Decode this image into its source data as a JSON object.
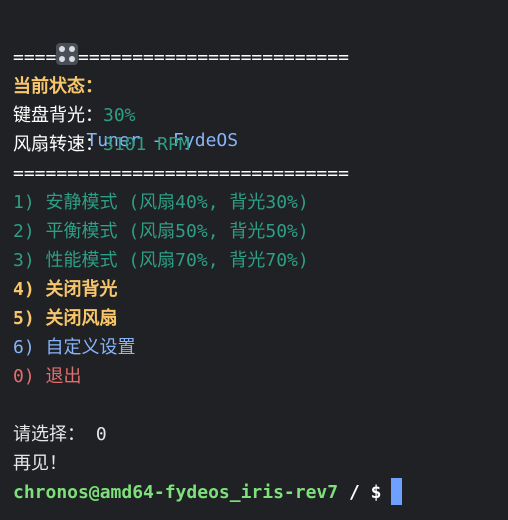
{
  "window": {
    "icon": "control-knobs-icon",
    "title": "Tuner - FydeOS"
  },
  "separator": "===============================",
  "status": {
    "header": "当前状态：",
    "backlight_label": "键盘背光：",
    "backlight_value": "30%",
    "fan_label": "风扇转速：",
    "fan_value": "3101 RPM"
  },
  "menu": [
    {
      "label": "1) 安静模式 (风扇40%, 背光30%)"
    },
    {
      "label": "2) 平衡模式 (风扇50%, 背光50%)"
    },
    {
      "label": "3) 性能模式 (风扇70%, 背光70%)"
    },
    {
      "label": "4) 关闭背光"
    },
    {
      "label": "5) 关闭风扇"
    },
    {
      "label": "6) 自定义设置"
    },
    {
      "label": "0) 退出"
    }
  ],
  "prompt_choice": "请选择： 0",
  "goodbye": "再见！",
  "shell_prompt": {
    "user_host": "chronos@amd64-fydeos_iris-rev7",
    "path": " / $"
  },
  "colors": {
    "background": "#1f2124",
    "accent_blue": "#89b4fa",
    "green": "#2e9e86",
    "yellow": "#f9c76b",
    "red": "#e26e6e",
    "prompt_green": "#7ee07a",
    "cursor": "#6ea0ff"
  }
}
